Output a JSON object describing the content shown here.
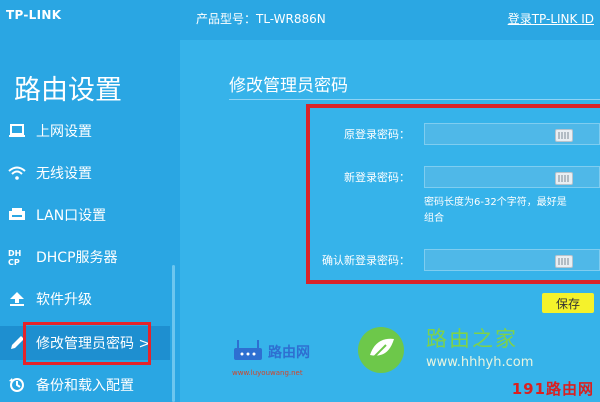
{
  "header": {
    "logo": "TP-LINK",
    "model_label": "产品型号：TL-WR886N",
    "login_link": "登录TP-LINK ID"
  },
  "sidebar": {
    "title": "路由设置",
    "items": [
      {
        "label": "上网设置",
        "icon": "laptop-icon"
      },
      {
        "label": "无线设置",
        "icon": "wifi-icon"
      },
      {
        "label": "LAN口设置",
        "icon": "lan-icon"
      },
      {
        "label": "DHCP服务器",
        "icon": "dhcp-icon"
      },
      {
        "label": "软件升级",
        "icon": "upload-icon"
      },
      {
        "label": "修改管理员密码 >",
        "icon": "pencil-icon",
        "active": true
      },
      {
        "label": "备份和载入配置",
        "icon": "restore-icon"
      }
    ]
  },
  "main": {
    "section_title": "修改管理员密码",
    "fields": [
      {
        "label": "原登录密码：",
        "value": ""
      },
      {
        "label": "新登录密码：",
        "value": ""
      },
      {
        "label": "确认新登录密码：",
        "value": ""
      }
    ],
    "hint_line1": "密码长度为6-32个字符，最好是",
    "hint_line2": "组合",
    "save_label": "保存"
  },
  "watermarks": {
    "w1_text": "路由网",
    "w1_url": "www.luyouwang.net",
    "w2_text": "路由之家",
    "w2_url": "www.hhhyh.com",
    "w3_text": "191路由网"
  },
  "colors": {
    "sidebar_bg": "#2aa6e3",
    "content_bg": "#36b3ea",
    "highlight_red": "#e5232a",
    "save_yellow": "#f5f22b"
  }
}
